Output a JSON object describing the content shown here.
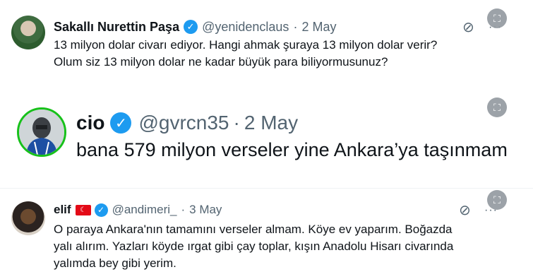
{
  "tweets": [
    {
      "name": "Sakallı Nurettin Paşa",
      "handle": "@yenidenclaus",
      "separator": "·",
      "date": "2 May",
      "text": "13 milyon dolar civarı ediyor. Hangi ahmak şuraya 13 milyon dolar verir?\nOlum siz 13 milyon dolar ne kadar büyük para biliyormusunuz?",
      "verified_glyph": "✓",
      "icons": {
        "grok": "⊘",
        "more": "···",
        "expand": "⛶"
      }
    },
    {
      "name": "cio",
      "handle": "@gvrcn35",
      "separator": "·",
      "date": "2 May",
      "text": "bana 579 milyon verseler yine Ankara’ya taşınmam",
      "verified_glyph": "✓",
      "icons": {
        "expand": "⛶"
      }
    },
    {
      "name": "elif",
      "flag": "☾",
      "handle": "@andimeri_",
      "separator": "·",
      "date": "3 May",
      "text": "O paraya Ankara'nın tamamını verseler almam. Köye ev yaparım. Boğazda\nyalı alırım. Yazları köyde ırgat gibi çay toplar, kışın Anadolu Hisarı civarında\nyalımda bey gibi yerim.",
      "verified_glyph": "✓",
      "icons": {
        "grok": "⊘",
        "more": "···",
        "expand": "⛶"
      }
    }
  ],
  "colors": {
    "verified": "#1d9bf0",
    "secondary_text": "#536471",
    "primary_text": "#0f1419",
    "avatar_ring": "#17c11a",
    "flag_red": "#e30a17"
  }
}
